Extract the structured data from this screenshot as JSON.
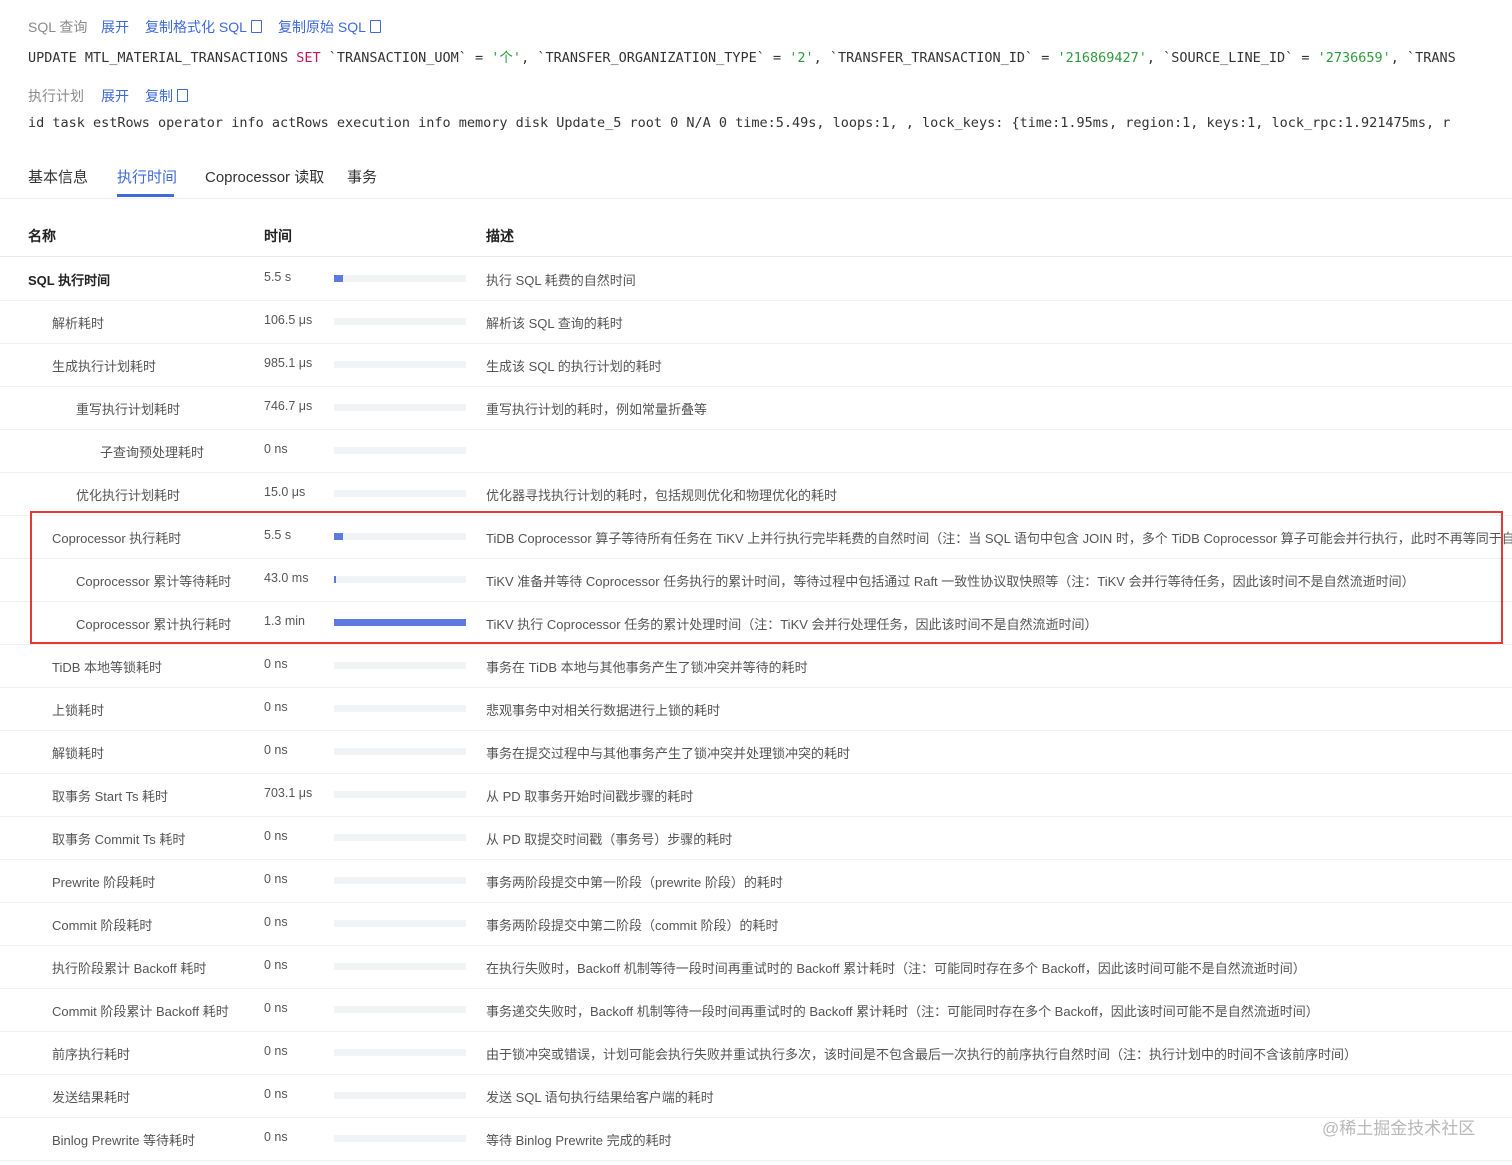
{
  "sql_section": {
    "label": "SQL 查询",
    "expand": "展开",
    "copy_formatted": "复制格式化 SQL",
    "copy_raw": "复制原始 SQL",
    "statement": {
      "p1": "UPDATE MTL_MATERIAL_TRANSACTIONS ",
      "kw": "SET",
      "p2": " `TRANSACTION_UOM` = ",
      "s1": "'个'",
      "p3": ", `TRANSFER_ORGANIZATION_TYPE` = ",
      "s2": "'2'",
      "p4": ", `TRANSFER_TRANSACTION_ID` = ",
      "s3": "'216869427'",
      "p5": ", `SOURCE_LINE_ID` = ",
      "s4": "'2736659'",
      "p6": ", `TRANS"
    }
  },
  "plan_section": {
    "label": "执行计划",
    "expand": "展开",
    "copy": "复制",
    "text": "id task estRows operator info actRows execution info memory disk Update_5 root 0 N/A 0 time:5.49s, loops:1, , lock_keys: {time:1.95ms, region:1, keys:1, lock_rpc:1.921475ms, r"
  },
  "tabs": [
    "基本信息",
    "执行时间",
    "Coprocessor 读取",
    "事务"
  ],
  "active_tab": "执行时间",
  "table": {
    "headers": {
      "name": "名称",
      "time": "时间",
      "desc": "描述"
    },
    "rows": [
      {
        "name": "SQL 执行时间",
        "time": "5.5 s",
        "bar": 0.07,
        "desc": "执行 SQL 耗费的自然时间"
      },
      {
        "name": "解析耗时",
        "time": "106.5 μs",
        "bar": 0,
        "desc": "解析该 SQL 查询的耗时"
      },
      {
        "name": "生成执行计划耗时",
        "time": "985.1 μs",
        "bar": 0,
        "desc": "生成该 SQL 的执行计划的耗时"
      },
      {
        "name": "重写执行计划耗时",
        "time": "746.7 μs",
        "bar": 0,
        "desc": "重写执行计划的耗时，例如常量折叠等"
      },
      {
        "name": "子查询预处理耗时",
        "time": "0 ns",
        "bar": 0,
        "desc": ""
      },
      {
        "name": "优化执行计划耗时",
        "time": "15.0 μs",
        "bar": 0,
        "desc": "优化器寻找执行计划的耗时，包括规则优化和物理优化的耗时"
      },
      {
        "name": "Coprocessor 执行耗时",
        "time": "5.5 s",
        "bar": 0.07,
        "desc": "TiDB Coprocessor 算子等待所有任务在 TiKV 上并行执行完毕耗费的自然时间（注：当 SQL 语句中包含 JOIN 时，多个 TiDB Coprocessor 算子可能会并行执行，此时不再等同于自然时间"
      },
      {
        "name": "Coprocessor 累计等待耗时",
        "time": "43.0 ms",
        "bar": 0.006,
        "desc": "TiKV 准备并等待 Coprocessor 任务执行的累计时间，等待过程中包括通过 Raft 一致性协议取快照等（注：TiKV 会并行等待任务，因此该时间不是自然流逝时间）"
      },
      {
        "name": "Coprocessor 累计执行耗时",
        "time": "1.3 min",
        "bar": 1.0,
        "desc": "TiKV 执行 Coprocessor 任务的累计处理时间（注：TiKV 会并行处理任务，因此该时间不是自然流逝时间）"
      },
      {
        "name": "TiDB 本地等锁耗时",
        "time": "0 ns",
        "bar": 0,
        "desc": "事务在 TiDB 本地与其他事务产生了锁冲突并等待的耗时"
      },
      {
        "name": "上锁耗时",
        "time": "0 ns",
        "bar": 0,
        "desc": "悲观事务中对相关行数据进行上锁的耗时"
      },
      {
        "name": "解锁耗时",
        "time": "0 ns",
        "bar": 0,
        "desc": "事务在提交过程中与其他事务产生了锁冲突并处理锁冲突的耗时"
      },
      {
        "name": "取事务 Start Ts 耗时",
        "time": "703.1 μs",
        "bar": 0,
        "desc": "从 PD 取事务开始时间戳步骤的耗时"
      },
      {
        "name": "取事务 Commit Ts 耗时",
        "time": "0 ns",
        "bar": 0,
        "desc": "从 PD 取提交时间戳（事务号）步骤的耗时"
      },
      {
        "name": "Prewrite 阶段耗时",
        "time": "0 ns",
        "bar": 0,
        "desc": "事务两阶段提交中第一阶段（prewrite 阶段）的耗时"
      },
      {
        "name": "Commit 阶段耗时",
        "time": "0 ns",
        "bar": 0,
        "desc": "事务两阶段提交中第二阶段（commit 阶段）的耗时"
      },
      {
        "name": "执行阶段累计 Backoff 耗时",
        "time": "0 ns",
        "bar": 0,
        "desc": "在执行失败时，Backoff 机制等待一段时间再重试时的 Backoff 累计耗时（注：可能同时存在多个 Backoff，因此该时间可能不是自然流逝时间）"
      },
      {
        "name": "Commit 阶段累计 Backoff 耗时",
        "time": "0 ns",
        "bar": 0,
        "desc": "事务递交失败时，Backoff 机制等待一段时间再重试时的 Backoff 累计耗时（注：可能同时存在多个 Backoff，因此该时间可能不是自然流逝时间）"
      },
      {
        "name": "前序执行耗时",
        "time": "0 ns",
        "bar": 0,
        "desc": "由于锁冲突或错误，计划可能会执行失败并重试执行多次，该时间是不包含最后一次执行的前序执行自然时间（注：执行计划中的时间不含该前序时间）"
      },
      {
        "name": "发送结果耗时",
        "time": "0 ns",
        "bar": 0,
        "desc": "发送 SQL 语句执行结果给客户端的耗时"
      },
      {
        "name": "Binlog Prewrite 等待耗时",
        "time": "0 ns",
        "bar": 0,
        "desc": "等待 Binlog Prewrite 完成的耗时"
      }
    ]
  },
  "watermark": "@稀土掘金技术社区",
  "colors": {
    "accent": "#3f6ad8",
    "bar": "#5b7be0",
    "highlight": "#e53935"
  }
}
